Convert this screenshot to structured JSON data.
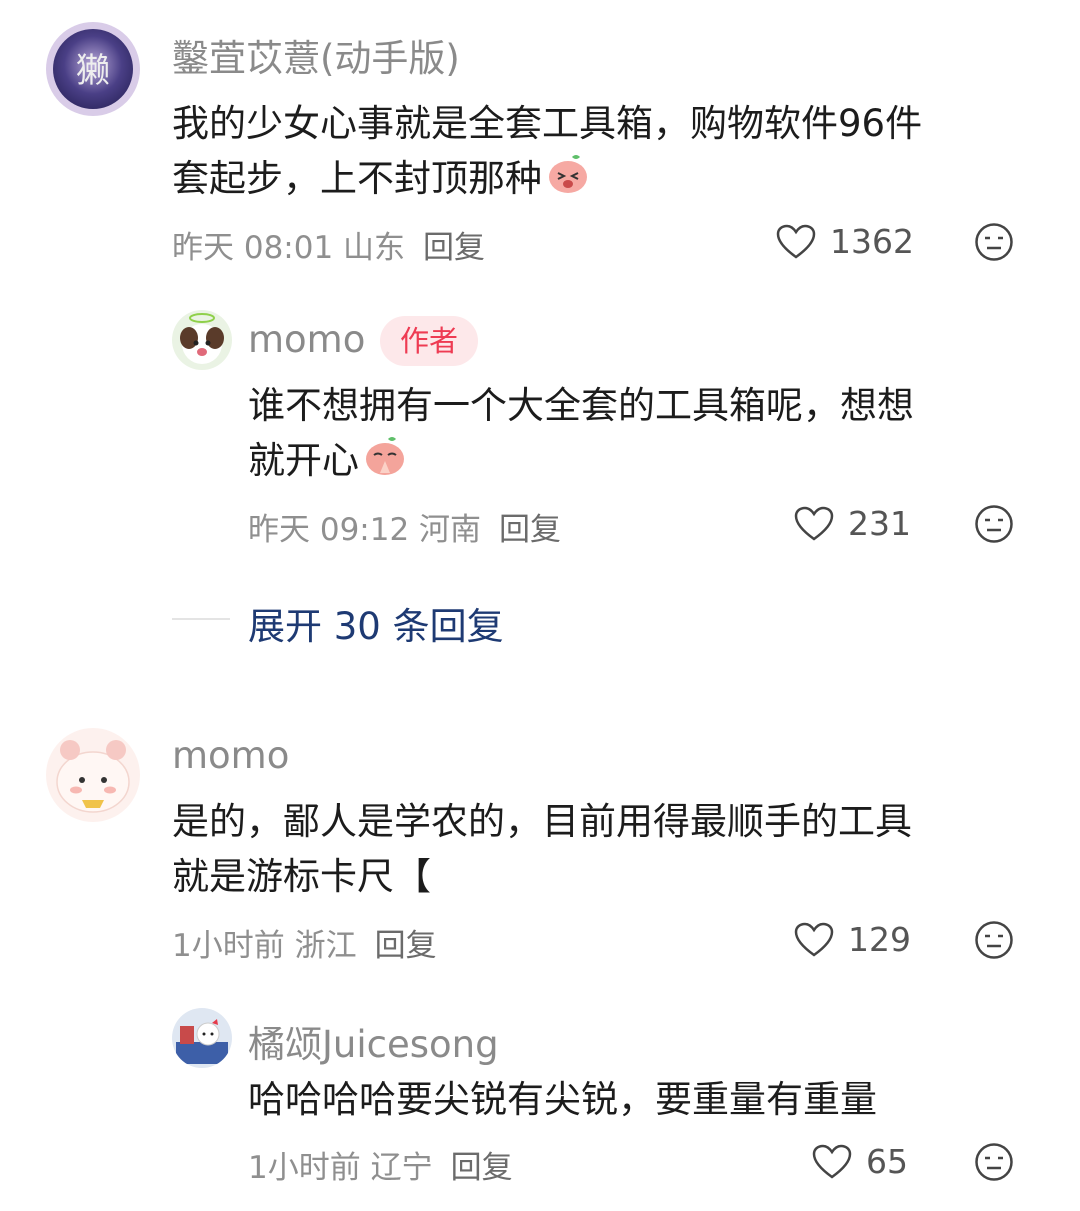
{
  "comments": [
    {
      "author": "鑿萓苡薏(动手版)",
      "line1": "我的少女心事就是全套工具箱，购物软件96件",
      "line2": "套起步，上不封顶那种",
      "time": "昨天 08:01 山东",
      "reply_label": "回复",
      "likes": "1362",
      "emoji": "laughing-emoji"
    },
    {
      "author": "momo",
      "badge": "作者",
      "line1": "谁不想拥有一个大全套的工具箱呢，想想",
      "line2": "就开心",
      "time": "昨天 09:12 河南",
      "reply_label": "回复",
      "likes": "231",
      "emoji": "praying-emoji"
    },
    {
      "author": "momo",
      "line1": "是的，鄙人是学农的，目前用得最顺手的工具",
      "line2": "就是游标卡尺【",
      "time": "1小时前 浙江",
      "reply_label": "回复",
      "likes": "129"
    },
    {
      "author": "橘颂Juicesong",
      "line1": "哈哈哈哈要尖锐有尖锐，要重量有重量",
      "time": "1小时前 辽宁",
      "reply_label": "回复",
      "likes": "65"
    }
  ],
  "expand_replies": "展开 30 条回复",
  "colors": {
    "author_badge_bg": "#fde8ea",
    "author_badge_text": "#ee3b53",
    "expand_text": "#1e3a73"
  }
}
